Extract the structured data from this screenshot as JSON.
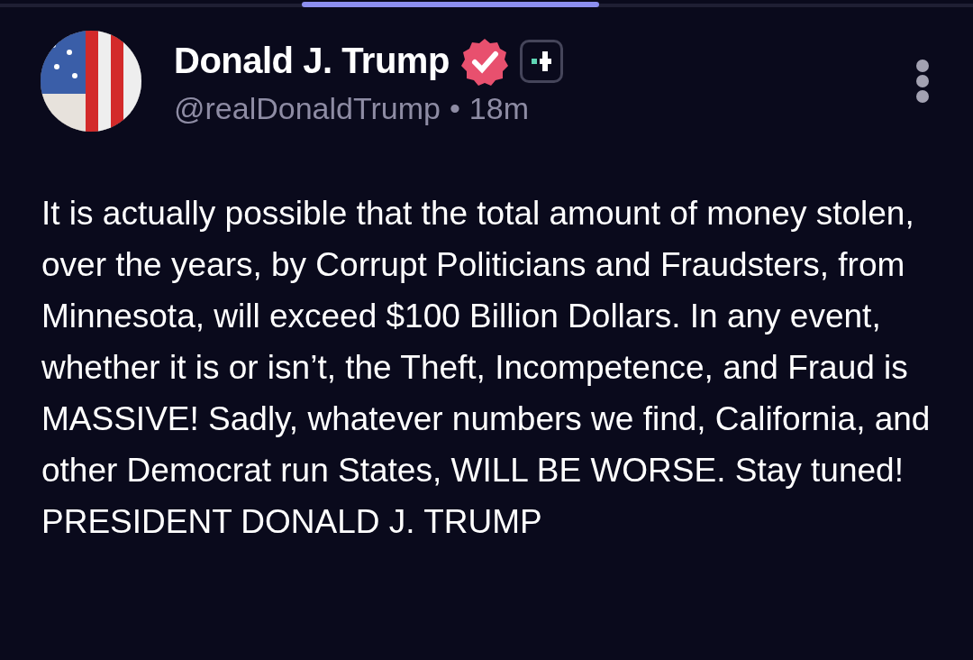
{
  "post": {
    "author": {
      "name": "Donald J. Trump",
      "handle": "@realDonaldTrump",
      "separator": "•",
      "time": "18m",
      "verified": true
    },
    "body": "It is actually possible that the total amount of money stolen, over the years, by Corrupt Politicians and Fraudsters, from Minnesota, will exceed $100 Billion Dollars. In any event, whether it is or isn’t, the Theft, Incompetence, and Fraud is MASSIVE! Sadly, whatever numbers we find, California, and other Democrat run States, WILL BE WORSE. Stay tuned! PRESIDENT DONALD J. TRUMP"
  }
}
